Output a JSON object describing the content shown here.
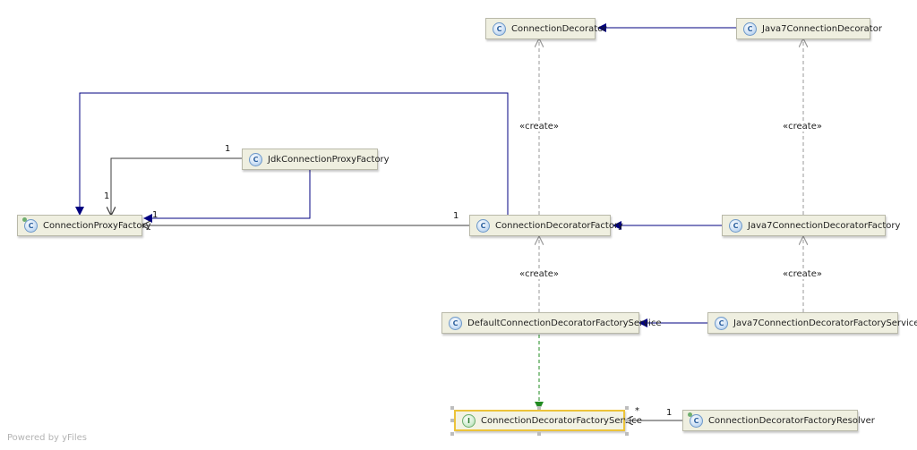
{
  "nodes": {
    "connection_decorator": {
      "label": "ConnectionDecorator",
      "kind": "C"
    },
    "java7_connection_decorator": {
      "label": "Java7ConnectionDecorator",
      "kind": "C"
    },
    "jdk_connection_proxy_factory": {
      "label": "JdkConnectionProxyFactory",
      "kind": "C"
    },
    "connection_proxy_factory": {
      "label": "ConnectionProxyFactory",
      "kind": "C"
    },
    "connection_decorator_factory": {
      "label": "ConnectionDecoratorFactory",
      "kind": "C"
    },
    "java7_connection_decorator_factory": {
      "label": "Java7ConnectionDecoratorFactory",
      "kind": "C"
    },
    "default_connection_decorator_factory_service": {
      "label": "DefaultConnectionDecoratorFactoryService",
      "kind": "C"
    },
    "java7_connection_decorator_factory_service": {
      "label": "Java7ConnectionDecoratorFactoryService",
      "kind": "C"
    },
    "connection_decorator_factory_service": {
      "label": "ConnectionDecoratorFactoryService",
      "kind": "I"
    },
    "connection_decorator_factory_resolver": {
      "label": "ConnectionDecoratorFactoryResolver",
      "kind": "C"
    }
  },
  "edge_labels": {
    "create": "«create»",
    "one": "1",
    "many": "*"
  },
  "colors": {
    "inheritance": "#000080",
    "dependency": "#9a9a9a",
    "association": "#3c3c3c",
    "realization": "#228b22",
    "selection": "#ecc33a"
  },
  "watermark": "Powered by yFiles"
}
